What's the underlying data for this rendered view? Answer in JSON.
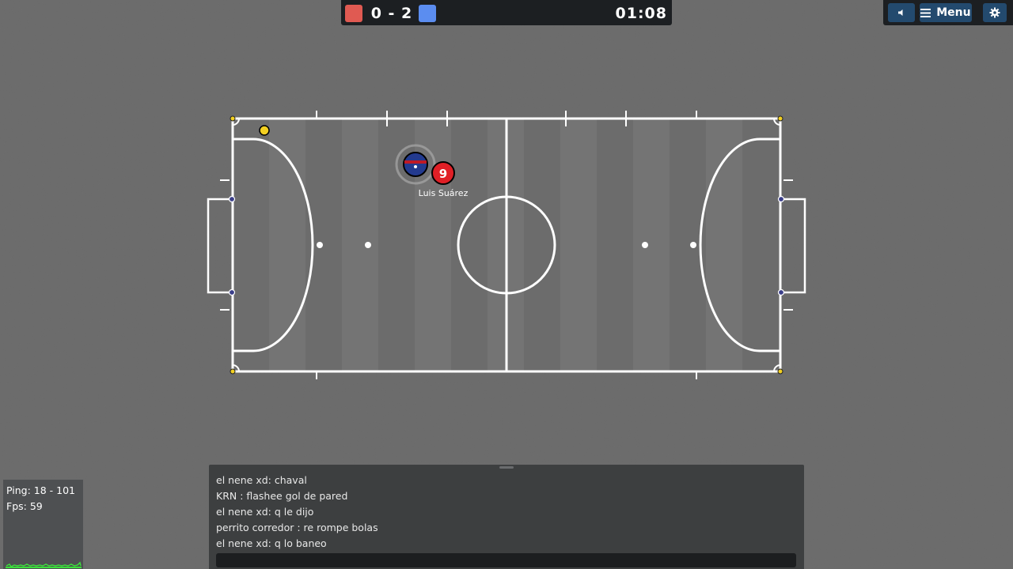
{
  "scoreboard": {
    "red_score": "0",
    "separator": "-",
    "blue_score": "2",
    "score_text": "0 - 2",
    "clock": "01:08",
    "red_color": "#e05a52",
    "blue_color": "#5b8df0"
  },
  "controls": {
    "sound_icon": "speaker-icon",
    "menu_label": "Menu",
    "menu_icon": "hamburger-icon",
    "settings_icon": "gear-icon"
  },
  "field": {
    "pitch_color": "#747474",
    "line_color": "#ffffff",
    "player_name": "Luis Suárez",
    "player_number": "9",
    "player_color": "#e01f26",
    "opponent_colors": [
      "#233a8f",
      "#c01a25"
    ],
    "ball_color": "#f3d021"
  },
  "chat": {
    "messages": [
      "el nene xd: chaval",
      "KRN : flashee gol de pared",
      "el nene xd: q le dijo",
      "perrito corredor : re rompe bolas",
      "el nene xd: q lo baneo"
    ],
    "input_value": ""
  },
  "stats": {
    "ping": "Ping: 18 - 101",
    "fps": "Fps: 59",
    "graph_color": "#3ce03c"
  }
}
